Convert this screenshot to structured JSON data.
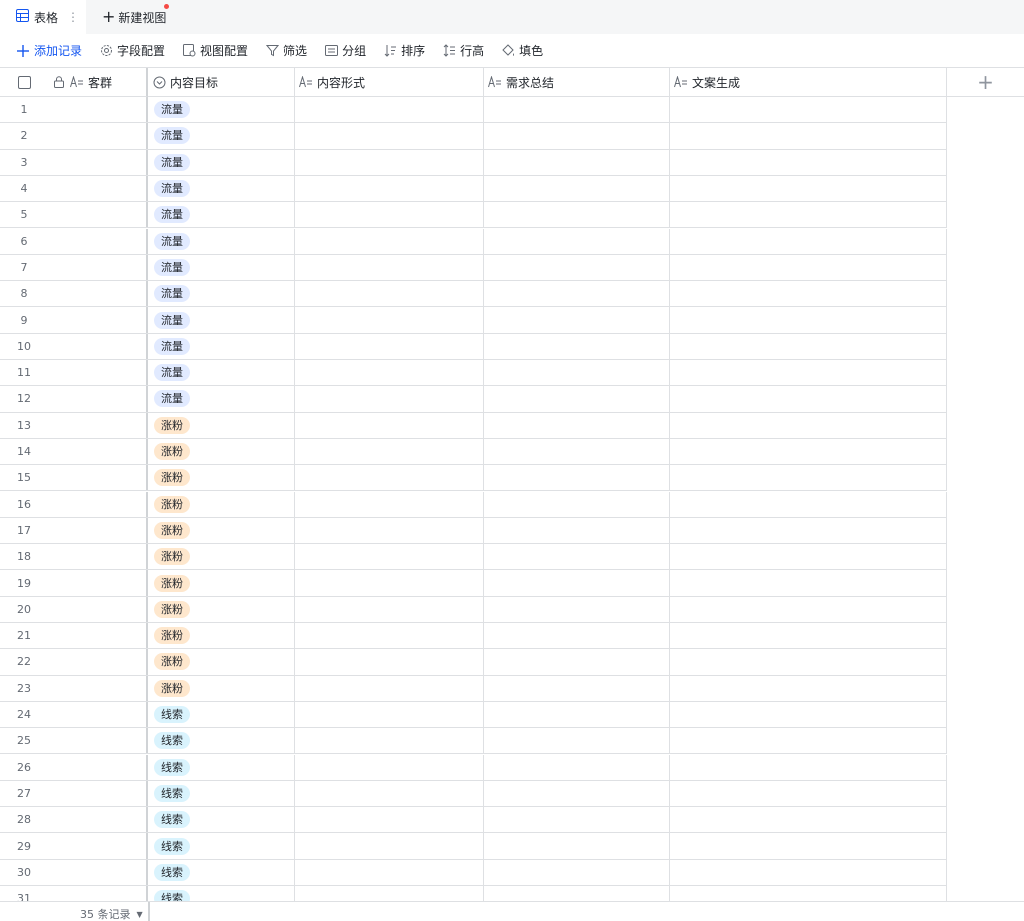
{
  "tabs": {
    "active": {
      "label": "表格",
      "more": "⋮"
    },
    "new_view": {
      "label": "新建视图",
      "plus": "+"
    }
  },
  "toolbar": {
    "add_record": "添加记录",
    "field_config": "字段配置",
    "view_config": "视图配置",
    "filter": "筛选",
    "group": "分组",
    "sort": "排序",
    "row_height": "行高",
    "fill_color": "填色"
  },
  "columns": {
    "group": "客群",
    "goal": "内容目标",
    "form": "内容形式",
    "need": "需求总结",
    "copy": "文案生成",
    "add": "+"
  },
  "rows": [
    {
      "num": "1",
      "goal": "流量"
    },
    {
      "num": "2",
      "goal": "流量"
    },
    {
      "num": "3",
      "goal": "流量"
    },
    {
      "num": "4",
      "goal": "流量"
    },
    {
      "num": "5",
      "goal": "流量"
    },
    {
      "num": "6",
      "goal": "流量"
    },
    {
      "num": "7",
      "goal": "流量"
    },
    {
      "num": "8",
      "goal": "流量"
    },
    {
      "num": "9",
      "goal": "流量"
    },
    {
      "num": "10",
      "goal": "流量"
    },
    {
      "num": "11",
      "goal": "流量"
    },
    {
      "num": "12",
      "goal": "流量"
    },
    {
      "num": "13",
      "goal": "涨粉"
    },
    {
      "num": "14",
      "goal": "涨粉"
    },
    {
      "num": "15",
      "goal": "涨粉"
    },
    {
      "num": "16",
      "goal": "涨粉"
    },
    {
      "num": "17",
      "goal": "涨粉"
    },
    {
      "num": "18",
      "goal": "涨粉"
    },
    {
      "num": "19",
      "goal": "涨粉"
    },
    {
      "num": "20",
      "goal": "涨粉"
    },
    {
      "num": "21",
      "goal": "涨粉"
    },
    {
      "num": "22",
      "goal": "涨粉"
    },
    {
      "num": "23",
      "goal": "涨粉"
    },
    {
      "num": "24",
      "goal": "线索"
    },
    {
      "num": "25",
      "goal": "线索"
    },
    {
      "num": "26",
      "goal": "线索"
    },
    {
      "num": "27",
      "goal": "线索"
    },
    {
      "num": "28",
      "goal": "线索"
    },
    {
      "num": "29",
      "goal": "线索"
    },
    {
      "num": "30",
      "goal": "线索"
    },
    {
      "num": "31",
      "goal": "线索"
    }
  ],
  "tag_colors": {
    "流量": "#e1eaff",
    "涨粉": "#fee7cd",
    "线索": "#d9f3fd"
  },
  "footer": {
    "count": "35 条记录",
    "arrow": "▼"
  },
  "accent_color": "#1456f0"
}
